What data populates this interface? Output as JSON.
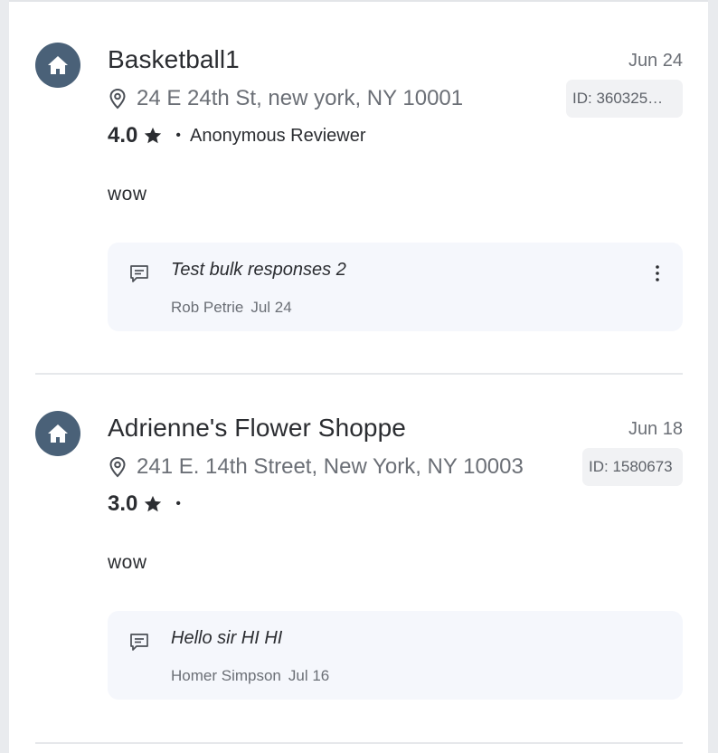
{
  "reviews": [
    {
      "business_name": "Basketball1",
      "date": "Jun 24",
      "address": "24 E 24th St, new york, NY 10001",
      "id_label": "ID: 360325…",
      "rating": "4.0",
      "reviewer": "Anonymous Reviewer",
      "text": "wow",
      "response": {
        "text": "Test bulk responses 2",
        "author": "Rob Petrie",
        "date": "Jul 24"
      }
    },
    {
      "business_name": "Adrienne's Flower Shoppe",
      "date": "Jun 18",
      "address": "241 E. 14th Street, New York, NY 10003",
      "id_label": "ID: 1580673",
      "rating": "3.0",
      "reviewer": "",
      "text": "wow",
      "response": {
        "text": "Hello sir HI HI",
        "author": "Homer Simpson",
        "date": "Jul 16"
      }
    }
  ],
  "icons": {
    "avatar": "home-icon",
    "address": "location-pin-icon",
    "rating": "star-icon",
    "response": "comment-icon",
    "menu": "kebab-menu-icon"
  },
  "colors": {
    "avatar_bg": "#4a6178",
    "response_bg": "#f5f7fc",
    "badge_bg": "#f1f2f4"
  }
}
